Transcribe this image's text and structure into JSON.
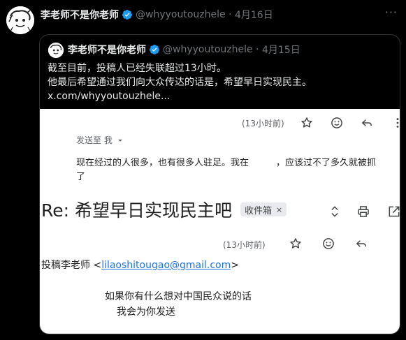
{
  "tweet": {
    "author_name": "李老师不是你老师",
    "handle": "@whyyoutouzhele",
    "date": "4月16日",
    "more": "···"
  },
  "quote": {
    "author_name": "李老师不是你老师",
    "handle": "@whyyoutouzhele",
    "date": "4月15日",
    "lines": [
      "截至目前，投稿人已经失联超过13小时。",
      "他最后希望通过我们向大众传达的话是，希望早日实现民主。",
      "x.com/whyyoutouzhele..."
    ]
  },
  "email": {
    "msg1": {
      "time": "(13小时前)",
      "to_label": "发送至 我",
      "body_line1": "现在经过的人很多，也有很多人驻足。我在　　　，应该过不了多久就被抓",
      "body_line2": "了"
    },
    "subject": "Re: 希望早日实现民主吧",
    "label_chip": "收件箱",
    "label_chip_close": "×",
    "msg2": {
      "time": "(13小时前)",
      "sender_name": "投稿李老师",
      "sender_email_open": "<",
      "sender_email": "lilaoshitougao@gmail.com",
      "sender_email_close": ">",
      "body_line1": "如果你有什么想对中国民众说的话",
      "body_line2": "我会为你发送"
    }
  },
  "colors": {
    "background": "#000000",
    "text": "#e7e9ea",
    "secondary_text": "#71767b",
    "verified": "#1d9bf0",
    "link": "#1a73e8",
    "border": "#2f3336"
  },
  "icons": [
    "verified-badge-icon",
    "star-icon",
    "emoji-icon",
    "reply-icon",
    "more-vert-icon",
    "dropdown-arrow-icon",
    "expand-icon",
    "print-icon",
    "open-new-window-icon"
  ]
}
